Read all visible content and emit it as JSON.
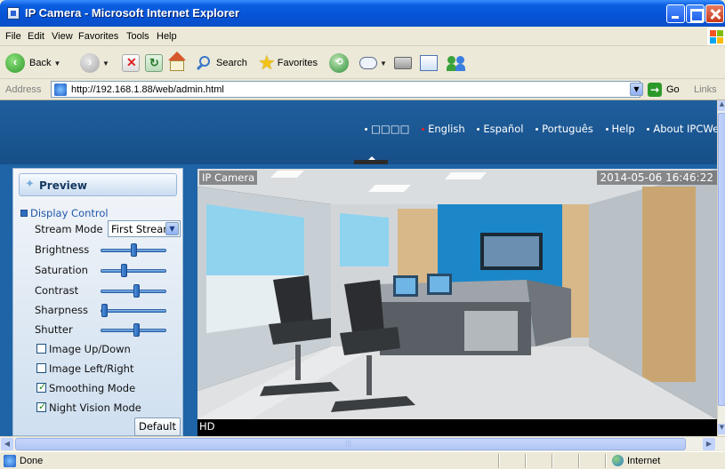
{
  "window": {
    "title": "IP Camera - Microsoft Internet Explorer",
    "controls": [
      "minimize",
      "maximize",
      "close"
    ]
  },
  "menubar": {
    "items": [
      "File",
      "Edit",
      "View",
      "Favorites",
      "Tools",
      "Help"
    ]
  },
  "toolbar": {
    "back_label": "Back",
    "search_label": "Search",
    "favorites_label": "Favorites",
    "icons": [
      "back-icon",
      "forward-icon",
      "stop-icon",
      "refresh-icon",
      "home-icon",
      "search-icon",
      "favorites-icon",
      "history-icon",
      "mail-icon",
      "print-icon",
      "edit-icon",
      "messenger-icon"
    ]
  },
  "addressbar": {
    "label": "Address",
    "url": "http://192.168.1.88/web/admin.html",
    "go_label": "Go",
    "links_label": "Links"
  },
  "page": {
    "nav": [
      {
        "label": "□□□□",
        "active": false
      },
      {
        "label": "English",
        "active": true
      },
      {
        "label": "Español",
        "active": false
      },
      {
        "label": "Português",
        "active": false
      },
      {
        "label": "Help",
        "active": false
      },
      {
        "label": "About IPCWeb",
        "active": false
      }
    ],
    "panel": {
      "title": "Preview",
      "section": "Display Control",
      "stream_mode_label": "Stream Mode",
      "stream_mode_value": "First Stream",
      "sliders": [
        {
          "label": "Brightness",
          "value": 0.5
        },
        {
          "label": "Saturation",
          "value": 0.35
        },
        {
          "label": "Contrast",
          "value": 0.55
        },
        {
          "label": "Sharpness",
          "value": 0.02
        },
        {
          "label": "Shutter",
          "value": 0.55
        }
      ],
      "checkboxes": [
        {
          "label": "Image Up/Down",
          "checked": false
        },
        {
          "label": "Image Left/Right",
          "checked": false
        },
        {
          "label": "Smoothing Mode",
          "checked": true
        },
        {
          "label": "Night Vision Mode",
          "checked": true
        }
      ],
      "default_button": "Default"
    },
    "camera": {
      "name": "IP Camera",
      "timestamp": "2014-05-06 16:46:22",
      "quality": "HD"
    }
  },
  "statusbar": {
    "status": "Done",
    "zone": "Internet"
  },
  "colors": {
    "header_blue": "#1f5f9d",
    "active_lang_dot": "#e22222",
    "xp_titlebar": "#0553d6"
  }
}
